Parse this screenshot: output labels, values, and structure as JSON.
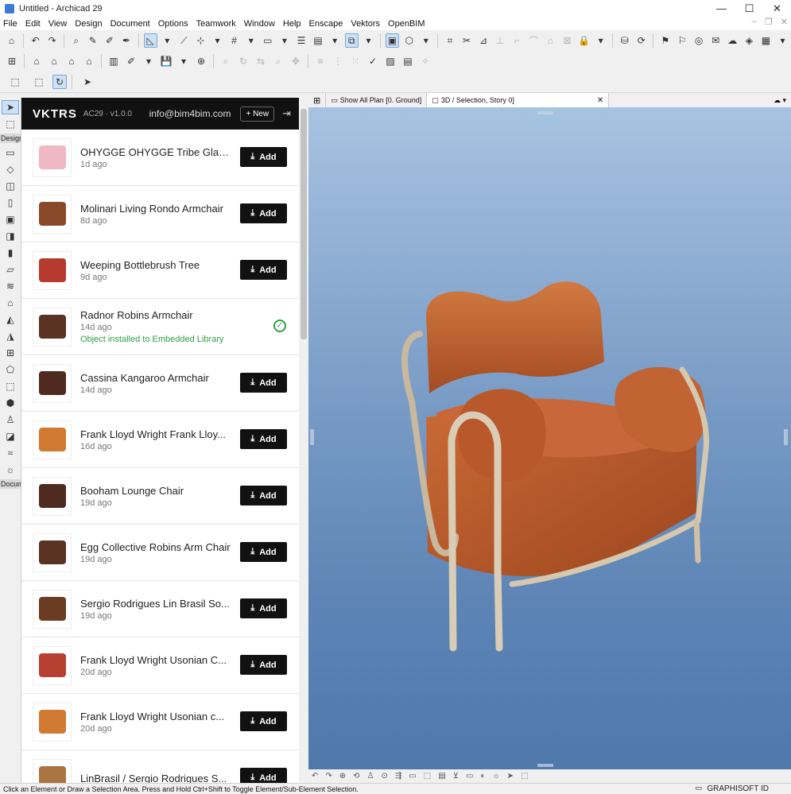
{
  "window": {
    "title": "Untitled - Archicad 29",
    "controls": [
      "—",
      "☐",
      "✕"
    ]
  },
  "menu": {
    "items": [
      "File",
      "Edit",
      "View",
      "Design",
      "Document",
      "Options",
      "Teamwork",
      "Window",
      "Help",
      "Enscape",
      "Vektors",
      "OpenBIM"
    ]
  },
  "toolbox": {
    "design_label": "Design",
    "document_label": "Docum"
  },
  "panel": {
    "logo": "VKTRS",
    "version": "AC29 · v1.0.0",
    "email": "info@bim4bim.com",
    "new_label": "+ New",
    "add_label": "Add",
    "items": [
      {
        "name": "OHYGGE OHYGGE Tribe Glare...",
        "age": "1d ago",
        "thumb_color": "#f0b7c4"
      },
      {
        "name": "Molinari Living Rondo Armchair",
        "age": "8d ago",
        "thumb_color": "#8a4a2a"
      },
      {
        "name": "Weeping Bottlebrush Tree",
        "age": "9d ago",
        "thumb_color": "#b73a2e"
      },
      {
        "name": "Radnor Robins Armchair",
        "age": "14d ago",
        "note": "Object installed to Embedded Library",
        "thumb_color": "#5b3324"
      },
      {
        "name": "Cassina Kangaroo Armchair",
        "age": "14d ago",
        "thumb_color": "#4e2b1e"
      },
      {
        "name": "Frank Lloyd Wright Frank Lloy...",
        "age": "16d ago",
        "thumb_color": "#d07a32"
      },
      {
        "name": "Booham Lounge Chair",
        "age": "19d ago",
        "thumb_color": "#4e2b1e"
      },
      {
        "name": "Egg Collective Robins Arm Chair",
        "age": "19d ago",
        "thumb_color": "#5b3324"
      },
      {
        "name": "Sergio Rodrigues Lin Brasil So...",
        "age": "19d ago",
        "thumb_color": "#6a3d22"
      },
      {
        "name": "Frank Lloyd Wright Usonian C...",
        "age": "20d ago",
        "thumb_color": "#b84032"
      },
      {
        "name": "Frank Lloyd Wright Usonian c...",
        "age": "20d ago",
        "thumb_color": "#d07a32"
      },
      {
        "name": "LinBrasil / Sergio Rodrigues S...",
        "age": "",
        "thumb_color": "#a9743f"
      }
    ]
  },
  "tabs": {
    "plan": "Show All Plan [0. Ground]",
    "view3d": "3D / Selection, Story 0]",
    "close": "✕"
  },
  "status": {
    "text": "Click an Element or Draw a Selection Area. Press and Hold Ctrl+Shift to Toggle Element/Sub-Element Selection.",
    "graphisoft_id": "GRAPHISOFT ID"
  },
  "colors": {
    "chair_fabric": "#c4622f",
    "chair_frame": "#d9cdb7",
    "sky_top": "#a7c3e1",
    "sky_bottom": "#4f78ab",
    "accent_green": "#2ea043"
  }
}
